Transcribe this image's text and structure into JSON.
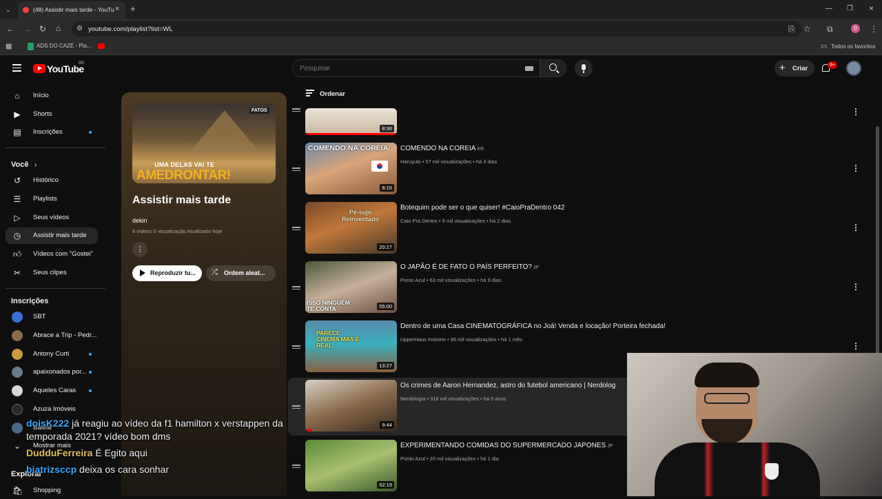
{
  "browser": {
    "tab_title": "(48) Assistir mais tarde - YouTube",
    "url": "youtube.com/playlist?list=WL",
    "bookmark_1": "ADS DO CAZE - Pla...",
    "all_favorites": "Todos os favoritos",
    "profile_letter": "D"
  },
  "header": {
    "logo_text": "YouTube",
    "logo_region": "BR",
    "search_placeholder": "Pesquisar",
    "create_label": "Criar",
    "notifications_badge": "9+"
  },
  "sidebar": {
    "main": [
      {
        "label": "Início",
        "icon": "home-icon"
      },
      {
        "label": "Shorts",
        "icon": "shorts-icon"
      },
      {
        "label": "Inscrições",
        "icon": "subscriptions-icon"
      }
    ],
    "you_heading": "Você",
    "you_items": [
      {
        "label": "Histórico",
        "icon": "history-icon"
      },
      {
        "label": "Playlists",
        "icon": "playlists-icon"
      },
      {
        "label": "Seus vídeos",
        "icon": "your-videos-icon"
      },
      {
        "label": "Assistir mais tarde",
        "icon": "watch-later-icon"
      },
      {
        "label": "Vídeos com \"Gostei\"",
        "icon": "like-icon"
      },
      {
        "label": "Seus clipes",
        "icon": "clips-icon"
      }
    ],
    "subs_heading": "Inscrições",
    "subs": [
      {
        "label": "SBT",
        "color": "#3a6fd8"
      },
      {
        "label": "Abrace a Trip - Pedr...",
        "color": "#8a6a4a"
      },
      {
        "label": "Antony Curti",
        "color": "#c89a3a"
      },
      {
        "label": "apaixonados por...",
        "color": "#6a7a8a"
      },
      {
        "label": "Aqueles Caras",
        "color": "#d8d8d8"
      },
      {
        "label": "Azuza Imóveis",
        "color": "#2a2a2a"
      },
      {
        "label": "Baleia",
        "color": "#4a6a8a"
      }
    ],
    "show_more": "Mostrar mais",
    "explore_heading": "Explorar",
    "shopping": "Shopping"
  },
  "playlist": {
    "thumb_text_1": "UMA DELAS VAI TE",
    "thumb_text_2": "AMEDRONTAR!",
    "thumb_badge": "FATOS",
    "title": "Assistir mais tarde",
    "owner": "dekin",
    "meta": "8 vídeos   0 visualização   Atualizado hoje",
    "play_all": "Reproduzir tu...",
    "shuffle": "Ordem aleat..."
  },
  "list": {
    "sort_label": "Ordenar",
    "videos": [
      {
        "title": "",
        "tag": "",
        "meta": "",
        "duration": "8:36",
        "thumb_text": ""
      },
      {
        "title": "COMENDO NA COREIA",
        "tag": "KR",
        "meta": "Haruyuki • 57 mil visualizações • há 3 dias",
        "duration": "8:15",
        "thumb_text": "COMENDO NA COREIA"
      },
      {
        "title": "Botequim pode ser o que quiser! #CaioPraDentro 042",
        "tag": "",
        "meta": "Caio Pra Dentro • 9 mil visualizações • há 2 dias",
        "duration": "20:27",
        "thumb_text": "Pé-sujo Reinventado"
      },
      {
        "title": "O JAPÃO É DE FATO O PAÍS PERFEITO?",
        "tag": "JP",
        "meta": "Ponto Azul • 63 mil visualizações • há 9 dias",
        "duration": "55:00",
        "thumb_text": "ISSO NINGUÉM TE CONTA"
      },
      {
        "title": "Dentro de uma Casa CINEMATOGRÁFICA no Joá! Venda e locação! Porteira fechada!",
        "tag": "",
        "meta": "UpperHaus Imóveis • 36 mil visualizações • há 1 mês",
        "duration": "13:27",
        "thumb_text": "PARECE CINEMA MAS É REAL"
      },
      {
        "title": "Os crimes de Aaron Hernandez, astro do futebol americano | Nerdolog",
        "tag": "",
        "meta": "Nerdologia • 318 mil visualizações • há 5 anos",
        "duration": "9:44",
        "thumb_text": ""
      },
      {
        "title": "EXPERIMENTANDO COMIDAS DO SUPERMERCADO JAPONES",
        "tag": "JP",
        "meta": "Ponto Azul • 20 mil visualizações • há 1 dia",
        "duration": "52:19",
        "thumb_text": ""
      }
    ]
  },
  "chat": [
    {
      "user": "doisK222",
      "user_color": "#3ea6ff",
      "text": "já reagiu ao vídeo da f1 hamilton x verstappen da",
      "text2": "temporada 2021? vídeo bom dms"
    },
    {
      "user": "DudduFerreira",
      "user_color": "#e0c060",
      "text": "É Egito aqui",
      "text2": ""
    },
    {
      "user": "biatrizsccp",
      "user_color": "#3ea6ff",
      "text": "deixa os cara sonhar",
      "text2": ""
    }
  ]
}
